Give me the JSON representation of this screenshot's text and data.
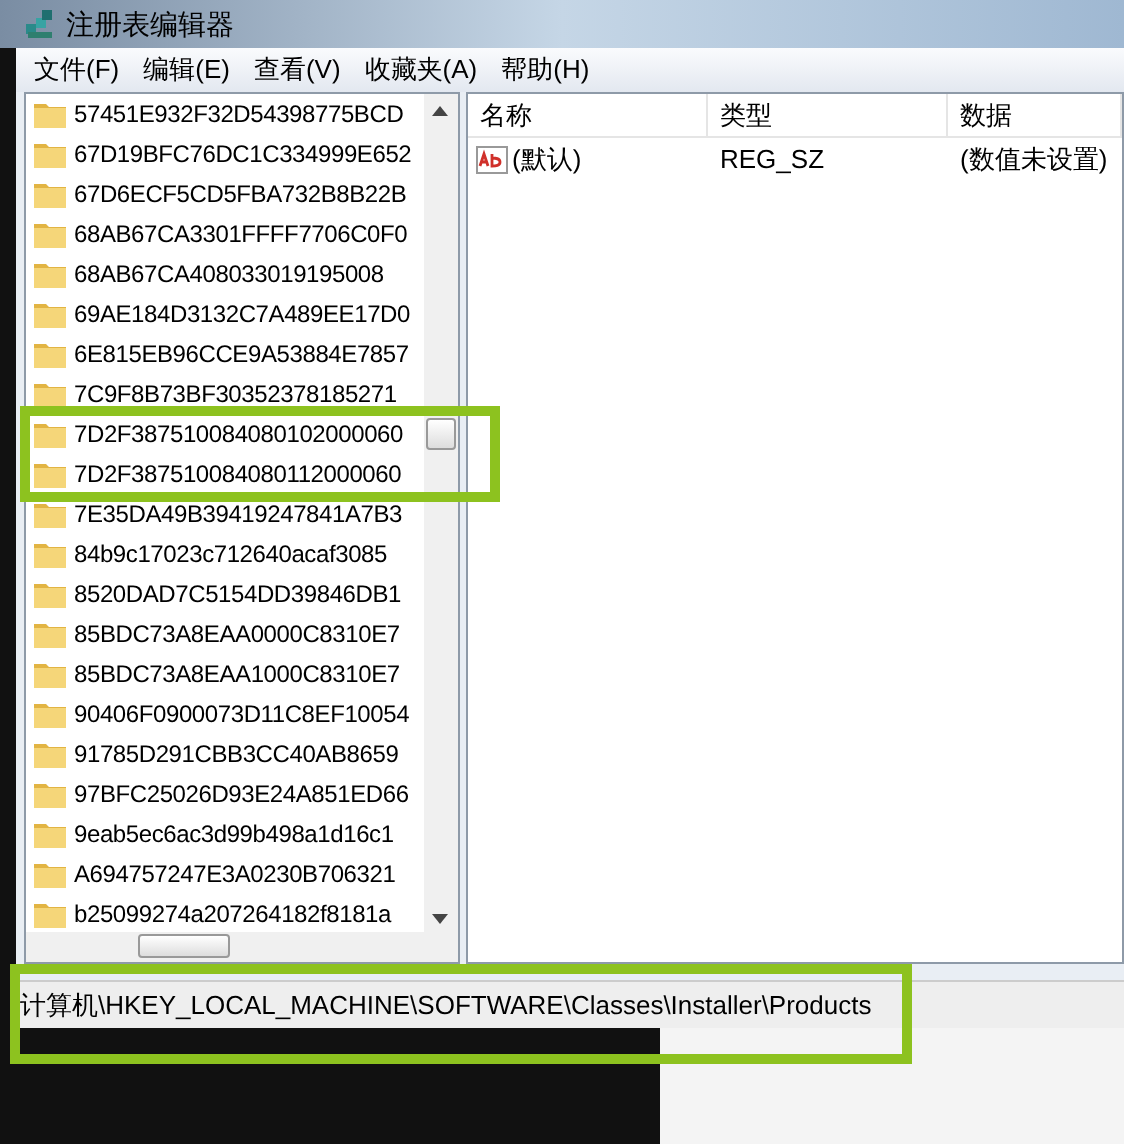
{
  "window": {
    "title": "注册表编辑器"
  },
  "menu": [
    "文件(F)",
    "编辑(E)",
    "查看(V)",
    "收藏夹(A)",
    "帮助(H)"
  ],
  "tree": {
    "items": [
      {
        "label": "57451E932F32D54398775BCD"
      },
      {
        "label": "67D19BFC76DC1C334999E652"
      },
      {
        "label": "67D6ECF5CD5FBA732B8B22B"
      },
      {
        "label": "68AB67CA3301FFFF7706C0F0"
      },
      {
        "label": "68AB67CA408033019195008"
      },
      {
        "label": "69AE184D3132C7A489EE17D0"
      },
      {
        "label": "6E815EB96CCE9A53884E7857"
      },
      {
        "label": "7C9F8B73BF30352378185271"
      },
      {
        "label": "7D2F387510084080102000060"
      },
      {
        "label": "7D2F387510084080112000060"
      },
      {
        "label": "7E35DA49B39419247841A7B3"
      },
      {
        "label": "84b9c17023c712640acaf3085"
      },
      {
        "label": "8520DAD7C5154DD39846DB1"
      },
      {
        "label": "85BDC73A8EAA0000C8310E7"
      },
      {
        "label": "85BDC73A8EAA1000C8310E7"
      },
      {
        "label": "90406F0900073D11C8EF10054"
      },
      {
        "label": "91785D291CBB3CC40AB8659"
      },
      {
        "label": "97BFC25026D93E24A851ED66"
      },
      {
        "label": "9eab5ec6ac3d99b498a1d16c1"
      },
      {
        "label": "A694757247E3A0230B706321"
      },
      {
        "label": "b25099274a207264182f8181a"
      }
    ]
  },
  "values": {
    "columns": [
      "名称",
      "类型",
      "数据"
    ],
    "rows": [
      {
        "name": "(默认)",
        "type": "REG_SZ",
        "data": "(数值未设置)"
      }
    ]
  },
  "status_bar": "计算机\\HKEY_LOCAL_MACHINE\\SOFTWARE\\Classes\\Installer\\Products"
}
